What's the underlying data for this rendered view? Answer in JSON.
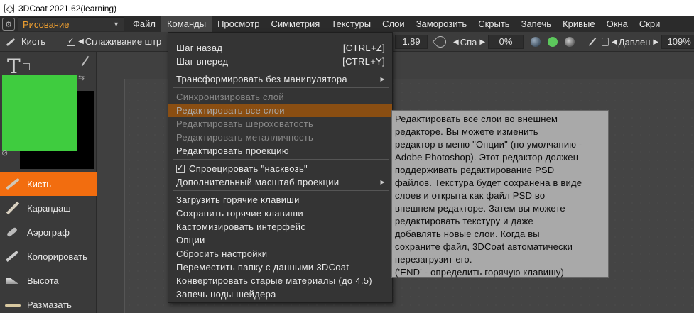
{
  "window": {
    "title": "3DCoat 2021.62(learning)"
  },
  "menubar": {
    "mode": "Рисование",
    "items": [
      "Файл",
      "Команды",
      "Просмотр",
      "Симметрия",
      "Текстуры",
      "Слои",
      "Заморозить",
      "Скрыть",
      "Запечь",
      "Кривые",
      "Окна",
      "Скри"
    ]
  },
  "toolbar": {
    "tool_label": "Кисть",
    "smoothing_label": "Сглаживание штр",
    "size_value": "1.89",
    "falloff_label": "Спа",
    "falloff_value": "0%",
    "pressure_label": "Давлен",
    "pressure_value": "109%",
    "green_color": "#5cc85c"
  },
  "leftpanel": {
    "primary_color": "#3fcc3f",
    "secondary_color": "#000000",
    "tools": [
      {
        "label": "Кисть",
        "icon": "brush-icon",
        "active": true
      },
      {
        "label": "Карандаш",
        "icon": "pencil-icon",
        "active": false
      },
      {
        "label": "Аэрограф",
        "icon": "airbrush-icon",
        "active": false
      },
      {
        "label": "Колорировать",
        "icon": "colorize-icon",
        "active": false
      },
      {
        "label": "Высота",
        "icon": "height-icon",
        "active": false
      },
      {
        "label": "Размазать",
        "icon": "smudge-icon",
        "active": false
      }
    ]
  },
  "dropdown": {
    "undo": {
      "label": "Шаг назад",
      "shortcut": "[CTRL+Z]"
    },
    "redo": {
      "label": "Шаг вперед",
      "shortcut": "[CTRL+Y]"
    },
    "transform": "Трансформировать без манипулятора",
    "sync_layer": "Синхронизировать слой",
    "edit_all_layers": "Редактировать все слои",
    "edit_roughness": "Редактировать шероховатость",
    "edit_metalness": "Редактировать металличность",
    "edit_projection": "Редактировать проекцию",
    "project_through": "Спроецировать \"насквозь\"",
    "extra_scale": "Дополнительный масштаб проекции",
    "load_hotkeys": "Загрузить горячие клавиши",
    "save_hotkeys": "Сохранить горячие клавиши",
    "customize_ui": "Кастомизировать интерфейс",
    "options": "Опции",
    "reset_settings": "Сбросить настройки",
    "move_data_folder": "Переместить папку с данными 3DCoat",
    "convert_materials": "Конвертировать старые материалы (до 4.5)",
    "bake_shader_nodes": "Запечь ноды шейдера"
  },
  "tooltip": {
    "lines": [
      "Редактировать все слои во внешнем",
      "редакторе. Вы можете изменить",
      "редактор в меню \"Опции\" (по умолчанию -",
      "Adobe Photoshop). Этот редактор должен",
      "поддерживать редактирование PSD",
      "файлов. Текстура будет сохранена в виде",
      "слоев и открыта как файл PSD во",
      "внешнем редакторе. Затем вы можете",
      "редактировать текстуру и даже",
      "добавлять новые слои. Когда вы",
      "сохраните файл, 3DCoat автоматически",
      "перезагрузит его.",
      "('END' - определить горячую клавишу)"
    ]
  }
}
